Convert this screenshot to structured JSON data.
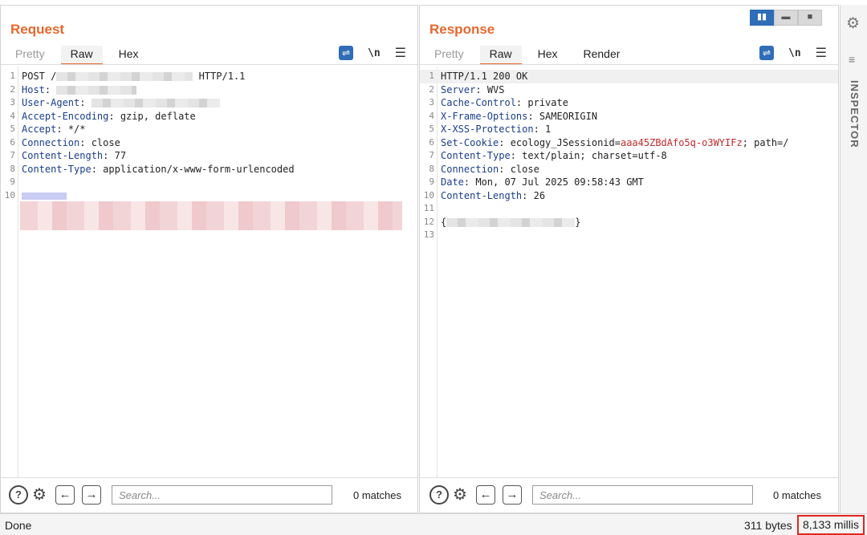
{
  "request": {
    "title": "Request",
    "tabs": [
      "Pretty",
      "Raw",
      "Hex"
    ],
    "active_tab": "Raw",
    "wrap_icon": "text-wrap-icon",
    "newline_label": "\\n",
    "menu_icon": "menu-icon",
    "lines": [
      {
        "n": "1",
        "key": "",
        "sep": "",
        "val": "POST /",
        "tail": " HTTP/1.1",
        "redact": true
      },
      {
        "n": "2",
        "key": "Host",
        "sep": ": ",
        "val": "",
        "tail": "",
        "redact": true
      },
      {
        "n": "3",
        "key": "User-Agent",
        "sep": ": ",
        "val": "",
        "tail": "",
        "redact": true
      },
      {
        "n": "4",
        "key": "Accept-Encoding",
        "sep": ": ",
        "val": "gzip, deflate"
      },
      {
        "n": "5",
        "key": "Accept",
        "sep": ": ",
        "val": "*/*"
      },
      {
        "n": "6",
        "key": "Connection",
        "sep": ": ",
        "val": "close"
      },
      {
        "n": "7",
        "key": "Content-Length",
        "sep": ": ",
        "val": "77"
      },
      {
        "n": "8",
        "key": "Content-Type",
        "sep": ": ",
        "val": "application/x-www-form-urlencoded"
      },
      {
        "n": "9",
        "key": "",
        "sep": "",
        "val": ""
      },
      {
        "n": "10",
        "key": "",
        "sep": "",
        "val": ""
      }
    ],
    "search_placeholder": "Search...",
    "matches": "0 matches"
  },
  "response": {
    "title": "Response",
    "tabs": [
      "Pretty",
      "Raw",
      "Hex",
      "Render"
    ],
    "active_tab": "Raw",
    "newline_label": "\\n",
    "lines": [
      {
        "n": "1",
        "key": "",
        "sep": "",
        "val": "HTTP/1.1 200 OK"
      },
      {
        "n": "2",
        "key": "Server",
        "sep": ": ",
        "val": "WVS"
      },
      {
        "n": "3",
        "key": "Cache-Control",
        "sep": ": ",
        "val": "private"
      },
      {
        "n": "4",
        "key": "X-Frame-Options",
        "sep": ": ",
        "val": "SAMEORIGIN"
      },
      {
        "n": "5",
        "key": "X-XSS-Protection",
        "sep": ": ",
        "val": "1"
      },
      {
        "n": "6",
        "key": "Set-Cookie",
        "sep": ": ",
        "val": "ecology_JSessionid=",
        "cookie": "aaa45ZBdAfo5q-o3WYIFz",
        "tail": "; path=/"
      },
      {
        "n": "7",
        "key": "Content-Type",
        "sep": ": ",
        "val": "text/plain; charset=utf-8"
      },
      {
        "n": "8",
        "key": "Connection",
        "sep": ": ",
        "val": "close"
      },
      {
        "n": "9",
        "key": "Date",
        "sep": ": ",
        "val": "Mon, 07 Jul 2025 09:58:43 GMT"
      },
      {
        "n": "10",
        "key": "Content-Length",
        "sep": ": ",
        "val": "26"
      },
      {
        "n": "11",
        "key": "",
        "sep": "",
        "val": ""
      },
      {
        "n": "12",
        "key": "",
        "sep": "",
        "val": "{",
        "tail": "}",
        "redact": true
      },
      {
        "n": "13",
        "key": "",
        "sep": "",
        "val": ""
      }
    ],
    "search_placeholder": "Search...",
    "matches": "0 matches"
  },
  "inspector": {
    "label": "INSPECTOR"
  },
  "status": {
    "left": "Done",
    "bytes": "311 bytes",
    "time": "8,133 millis"
  },
  "colors": {
    "accent": "#e8672c",
    "header_key": "#1a3d8f",
    "cookie_value": "#c62a2a",
    "highlight_box": "#e0261e",
    "button_blue": "#2f6db6"
  }
}
